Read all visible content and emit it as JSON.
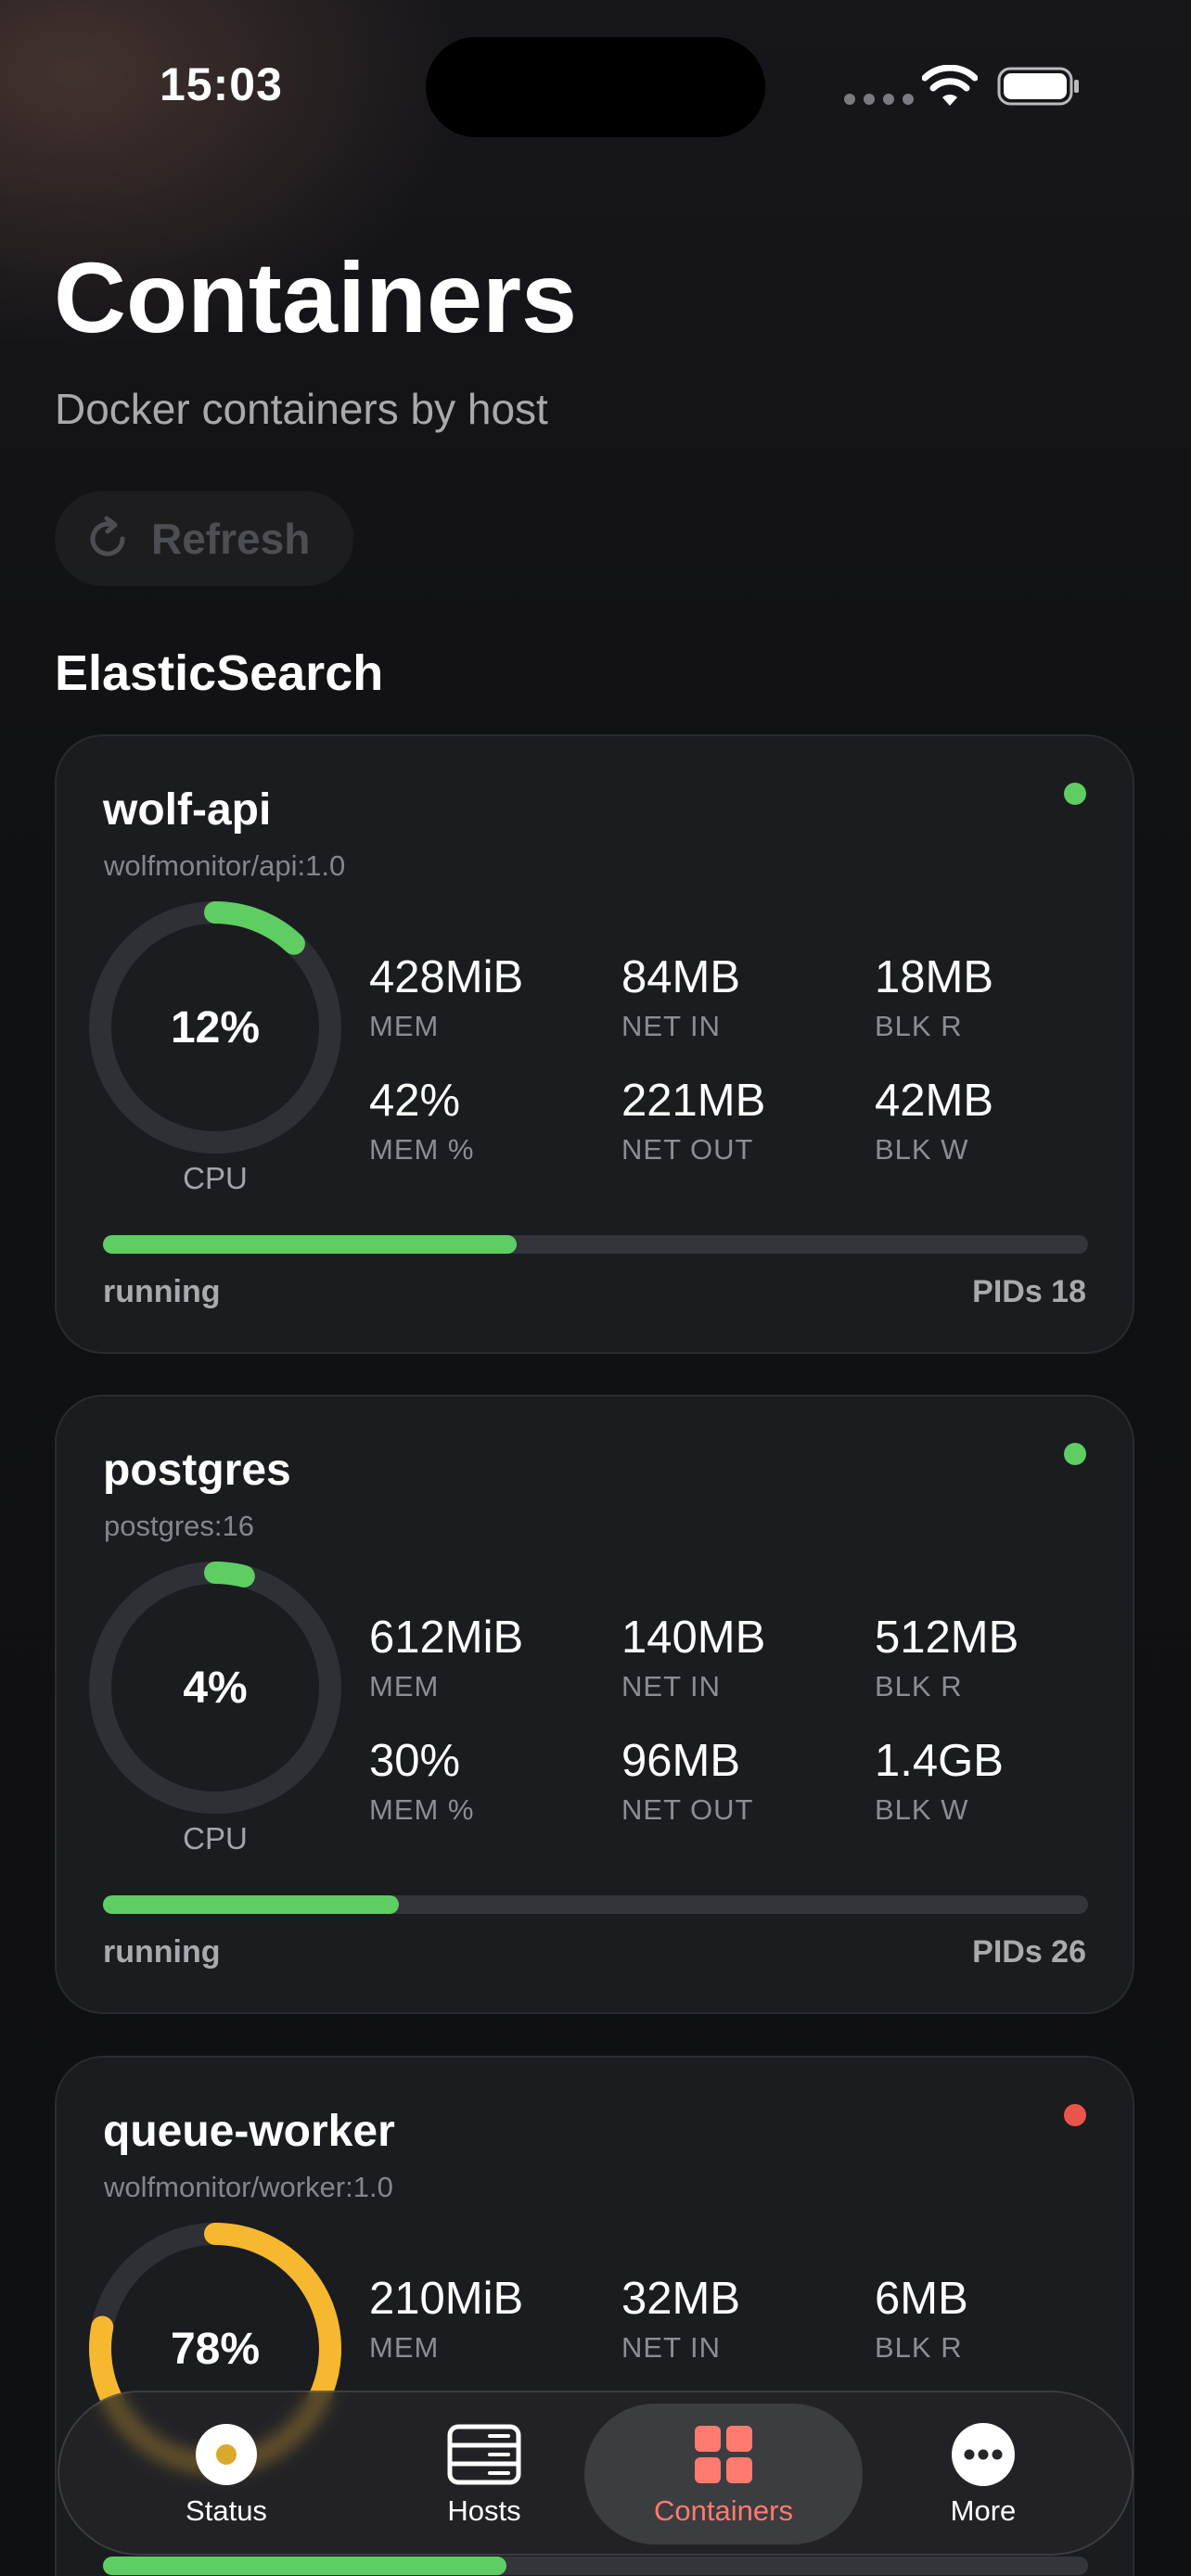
{
  "status_bar": {
    "time": "15:03"
  },
  "header": {
    "title": "Containers",
    "subtitle": "Docker containers by host",
    "refresh_label": "Refresh"
  },
  "section": {
    "title": "ElasticSearch"
  },
  "containers": [
    {
      "name": "wolf-api",
      "image": "wolfmonitor/api:1.0",
      "status_color": "#5ece62",
      "cpu_percent": 12,
      "cpu_text": "12%",
      "cpu_label": "CPU",
      "metrics": {
        "mem": "428MiB",
        "mem_label": "MEM",
        "net_in": "84MB",
        "net_in_label": "NET IN",
        "blk_r": "18MB",
        "blk_r_label": "BLK R",
        "mem_pct": "42%",
        "mem_pct_label": "MEM %",
        "net_out": "221MB",
        "net_out_label": "NET OUT",
        "blk_w": "42MB",
        "blk_w_label": "BLK W"
      },
      "mem_fraction": 0.42,
      "state": "running",
      "pids": "PIDs 18"
    },
    {
      "name": "postgres",
      "image": "postgres:16",
      "status_color": "#5ece62",
      "cpu_percent": 4,
      "cpu_text": "4%",
      "cpu_label": "CPU",
      "metrics": {
        "mem": "612MiB",
        "mem_label": "MEM",
        "net_in": "140MB",
        "net_in_label": "NET IN",
        "blk_r": "512MB",
        "blk_r_label": "BLK R",
        "mem_pct": "30%",
        "mem_pct_label": "MEM %",
        "net_out": "96MB",
        "net_out_label": "NET OUT",
        "blk_w": "1.4GB",
        "blk_w_label": "BLK W"
      },
      "mem_fraction": 0.3,
      "state": "running",
      "pids": "PIDs 26"
    },
    {
      "name": "queue-worker",
      "image": "wolfmonitor/worker:1.0",
      "status_color": "#e8564b",
      "cpu_percent": 78,
      "cpu_text": "78%",
      "cpu_label": "CPU",
      "metrics": {
        "mem": "210MiB",
        "mem_label": "MEM",
        "net_in": "32MB",
        "net_in_label": "NET IN",
        "blk_r": "6MB",
        "blk_r_label": "BLK R"
      },
      "mem_fraction": 0.41
    }
  ],
  "colors": {
    "running": "#5ece62",
    "stopped": "#e8564b",
    "gauge_low": "#5ece62",
    "gauge_high": "#f5b82e",
    "accent": "#ff7a6e"
  },
  "tabs": [
    {
      "label": "Status",
      "icon": "status-ring-icon"
    },
    {
      "label": "Hosts",
      "icon": "server-rack-icon"
    },
    {
      "label": "Containers",
      "icon": "grid-squares-icon",
      "active": true
    },
    {
      "label": "More",
      "icon": "more-dots-icon"
    }
  ]
}
